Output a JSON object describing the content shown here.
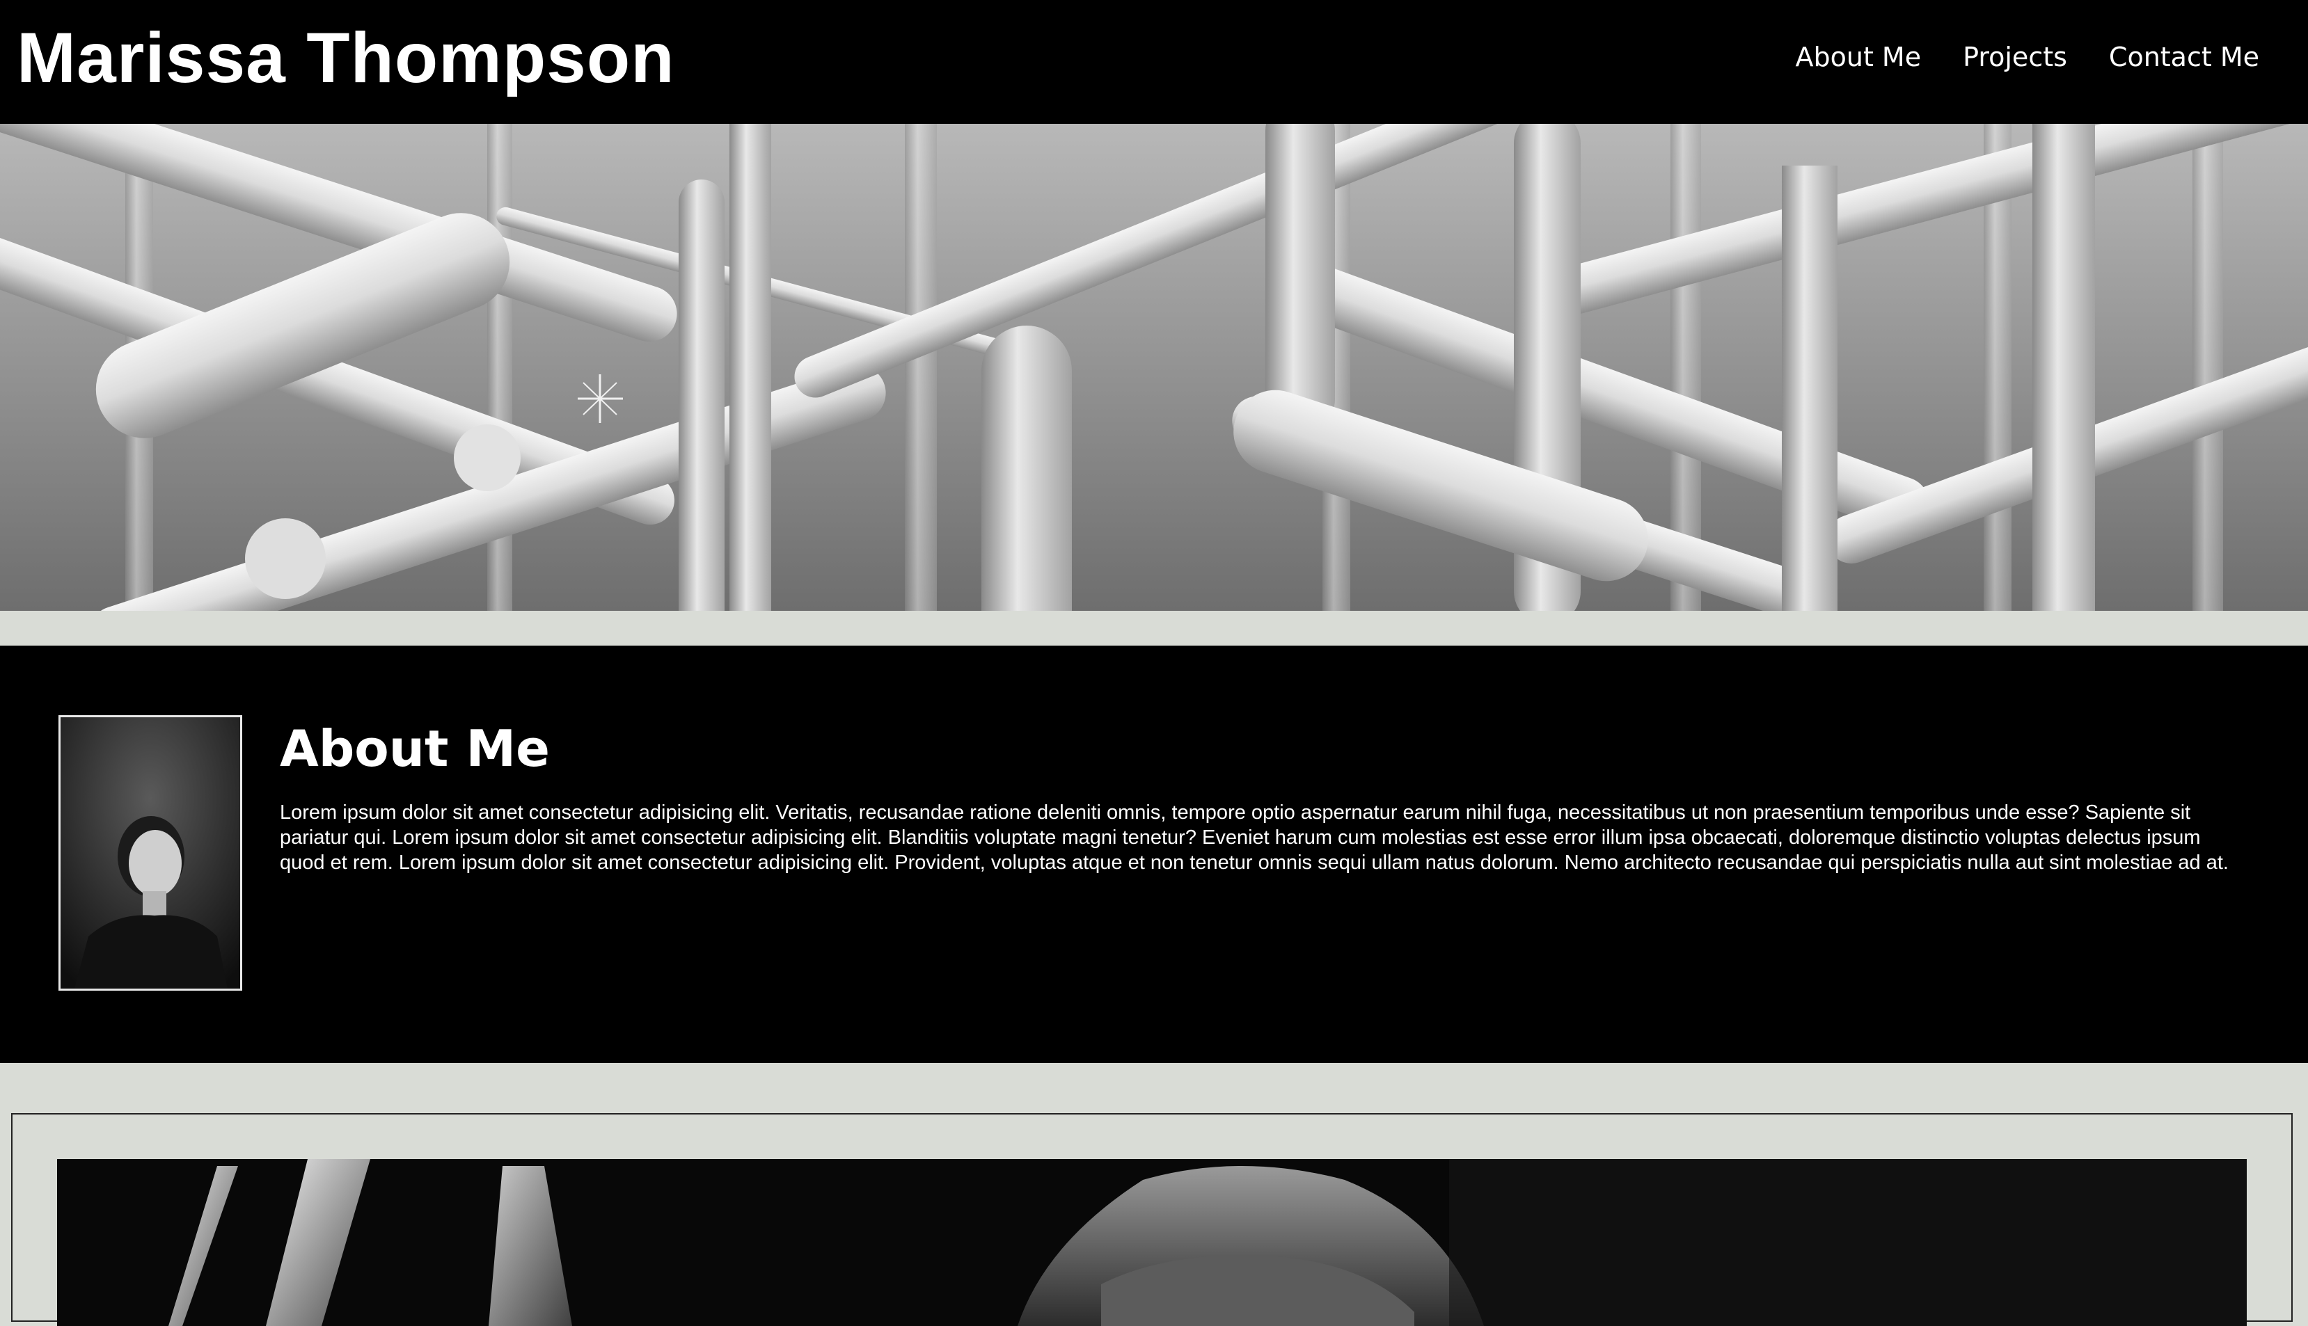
{
  "header": {
    "title": "Marissa Thompson",
    "nav": [
      {
        "label": "About Me"
      },
      {
        "label": "Projects"
      },
      {
        "label": "Contact Me"
      }
    ]
  },
  "about": {
    "heading": "About Me",
    "body": "Lorem ipsum dolor sit amet consectetur adipisicing elit. Veritatis, recusandae ratione deleniti omnis, tempore optio aspernatur earum nihil fuga, necessitatibus ut non praesentium temporibus unde esse? Sapiente sit pariatur qui. Lorem ipsum dolor sit amet consectetur adipisicing elit. Blanditiis voluptate magni tenetur? Eveniet harum cum molestias est esse error illum ipsa obcaecati, doloremque distinctio voluptas delectus ipsum quod et rem. Lorem ipsum dolor sit amet consectetur adipisicing elit. Provident, voluptas atque et non tenetur omnis sequi ullam natus dolorum. Nemo architecto recusandae qui perspiciatis nulla aut sint molestiae ad at."
  },
  "colors": {
    "header_bg": "#000000",
    "page_bg": "#d9dcd6",
    "text": "#ffffff"
  },
  "icons": {
    "hero": "abstract-white-pipes-image",
    "portrait": "person-portrait-photo",
    "project": "hands-project-photo"
  }
}
